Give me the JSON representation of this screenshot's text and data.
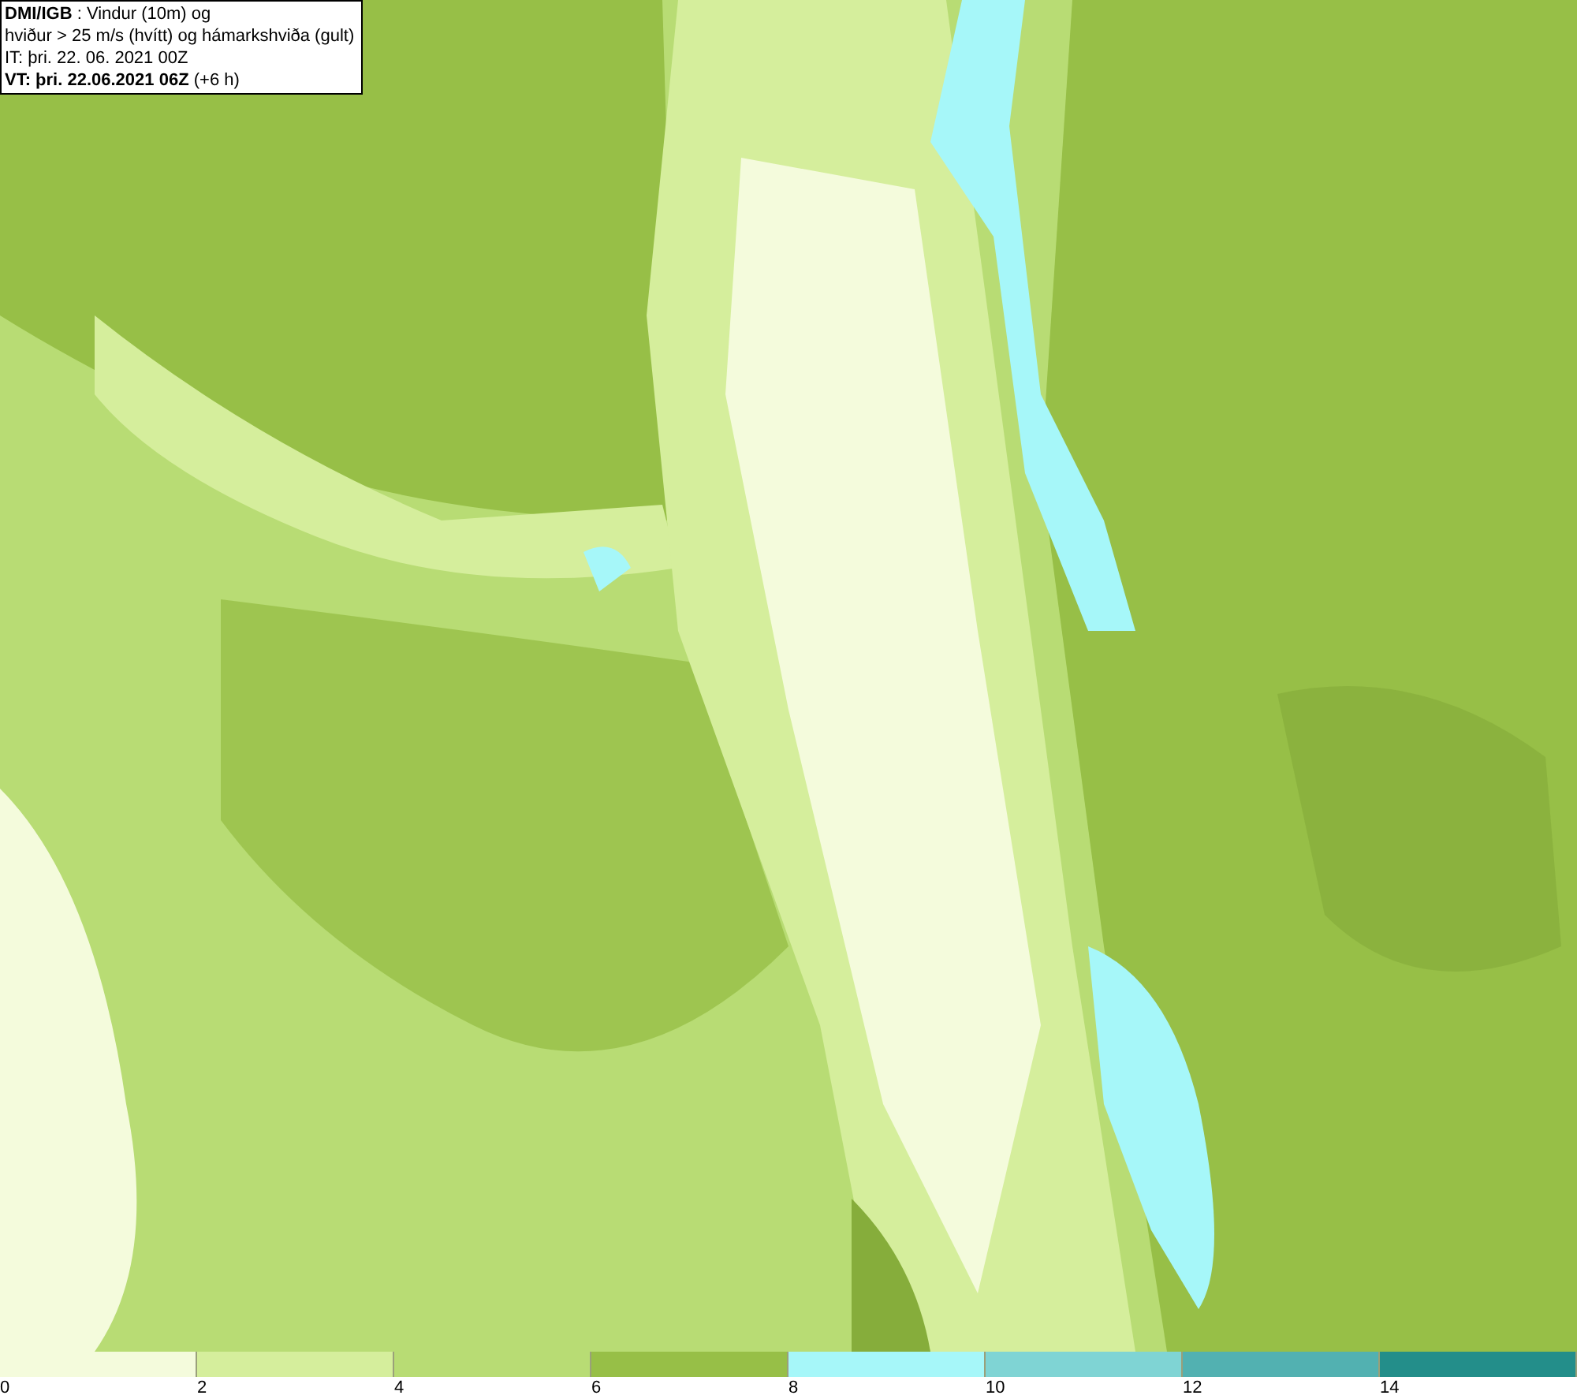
{
  "title_box": {
    "lines": [
      "**DMI/IGB** : Vindur (10m) og",
      "hviður > 25 m/s (hvítt) og hámarkshviða (gult)",
      "IT: þri. 22. 06. 2021 00Z",
      "**VT: þri. 22.06.2021 06Z** (+6 h)"
    ]
  },
  "legend": {
    "bins": [
      {
        "color": "#f4fbdc"
      },
      {
        "color": "#d5ee9c"
      },
      {
        "color": "#b8dc74"
      },
      {
        "color": "#97bf47"
      },
      {
        "color": "#a6f7f9"
      },
      {
        "color": "#7fd4d4"
      },
      {
        "color": "#52b1b1"
      },
      {
        "color": "#238e8a"
      }
    ],
    "ticks": [
      "0",
      "2",
      "4",
      "6",
      "8",
      "10",
      "12",
      "14"
    ]
  }
}
